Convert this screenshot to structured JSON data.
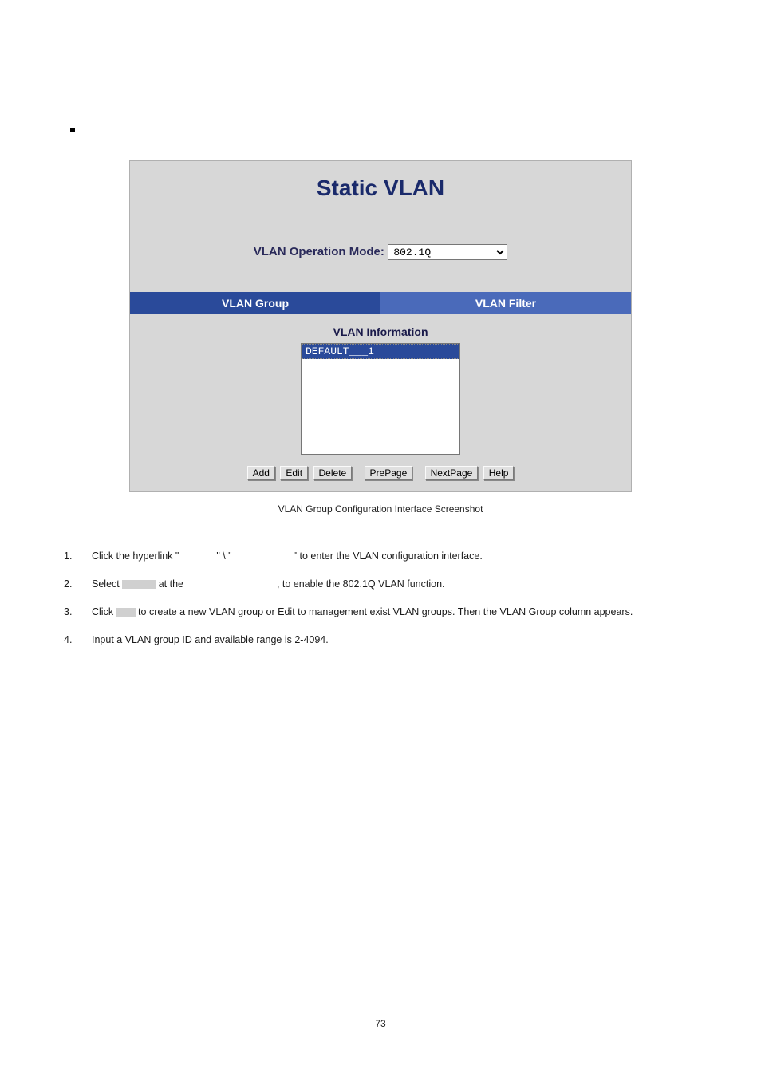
{
  "screenshot": {
    "title": "Static VLAN",
    "mode_label": "VLAN Operation Mode:",
    "mode_value": "802.1Q",
    "tabs": {
      "active": "VLAN Group",
      "inactive": "VLAN Filter"
    },
    "info_header": "VLAN Information",
    "list_item": "DEFAULT___1",
    "buttons": {
      "add": "Add",
      "edit": "Edit",
      "delete": "Delete",
      "prepage": "PrePage",
      "nextpage": "NextPage",
      "help": "Help"
    }
  },
  "caption": "VLAN Group Configuration Interface Screenshot",
  "steps": {
    "1": {
      "num": "1.",
      "pre": "Click the hyperlink \"",
      "mid1": "\" \\ \"",
      "post": "\" to enter the VLAN configuration interface."
    },
    "2": {
      "num": "2.",
      "pre": "Select ",
      "mid": " at the ",
      "post": ", to enable the 802.1Q VLAN function."
    },
    "3": {
      "num": "3.",
      "pre": "Click ",
      "post": " to create a new VLAN group or Edit to management exist VLAN groups. Then the VLAN Group column appears."
    },
    "4": {
      "num": "4.",
      "text": "Input a VLAN group ID and available range is 2-4094."
    }
  },
  "page_num": "73"
}
